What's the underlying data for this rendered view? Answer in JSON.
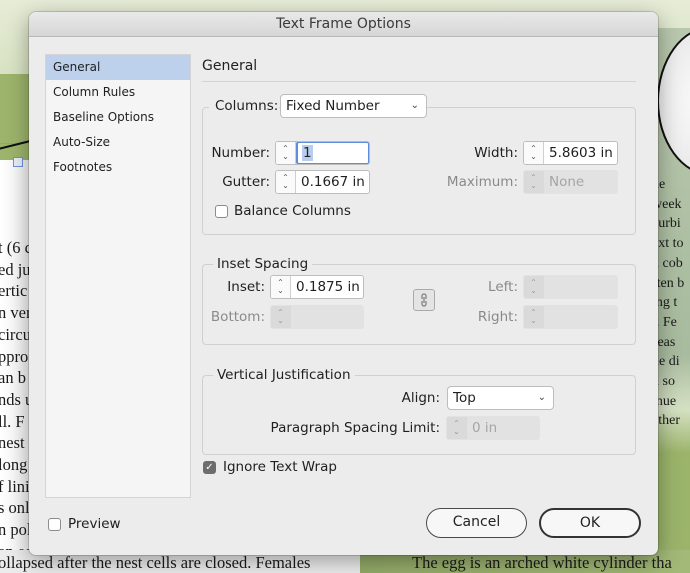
{
  "background": {
    "left_text_lines": [
      "t (6 c",
      "ed ju",
      "ertic",
      "n ver",
      "circu",
      "ppro",
      "an b",
      "nds u",
      "ll. F",
      "nest",
      "long",
      "f lini",
      "s onl",
      "n pol",
      "an eg"
    ],
    "right_text_lines": [
      "he",
      "week",
      "curbi",
      "ext to",
      "n cob",
      "ften b",
      "ing t",
      "r. Fe",
      " seas",
      "he di",
      "n so",
      "inue",
      "ather"
    ],
    "bottom_left_text": "ollapsed after the nest cells are closed. Females",
    "bottom_right_text": "The egg is an arched white cylinder tha"
  },
  "dialog": {
    "title": "Text Frame Options",
    "sidebar": {
      "items": [
        {
          "label": "General",
          "selected": true
        },
        {
          "label": "Column Rules",
          "selected": false
        },
        {
          "label": "Baseline Options",
          "selected": false
        },
        {
          "label": "Auto-Size",
          "selected": false
        },
        {
          "label": "Footnotes",
          "selected": false
        }
      ]
    },
    "panel_title": "General",
    "columns": {
      "label": "Columns:",
      "type_value": "Fixed Number",
      "number_label": "Number:",
      "number_value": "1",
      "gutter_label": "Gutter:",
      "gutter_value": "0.1667 in",
      "width_label": "Width:",
      "width_value": "5.8603 in",
      "maximum_label": "Maximum:",
      "maximum_value": "None",
      "balance_label": "Balance Columns",
      "balance_checked": false
    },
    "inset_spacing": {
      "legend": "Inset Spacing",
      "inset_label": "Inset:",
      "inset_value": "0.1875 in",
      "bottom_label": "Bottom:",
      "bottom_value": "",
      "left_label": "Left:",
      "left_value": "",
      "right_label": "Right:",
      "right_value": "",
      "link_icon": "chain-link-icon"
    },
    "vertical_justification": {
      "legend": "Vertical Justification",
      "align_label": "Align:",
      "align_value": "Top",
      "para_limit_label": "Paragraph Spacing Limit:",
      "para_limit_value": "0 in"
    },
    "ignore_text_wrap": {
      "label": "Ignore Text Wrap",
      "checked": true
    },
    "preview": {
      "label": "Preview",
      "checked": false
    },
    "buttons": {
      "cancel": "Cancel",
      "ok": "OK"
    },
    "icons": {
      "spinner_up": "⌃",
      "spinner_down": "⌄",
      "chevron": "⌄",
      "check": "✓",
      "link": "🔗"
    }
  }
}
